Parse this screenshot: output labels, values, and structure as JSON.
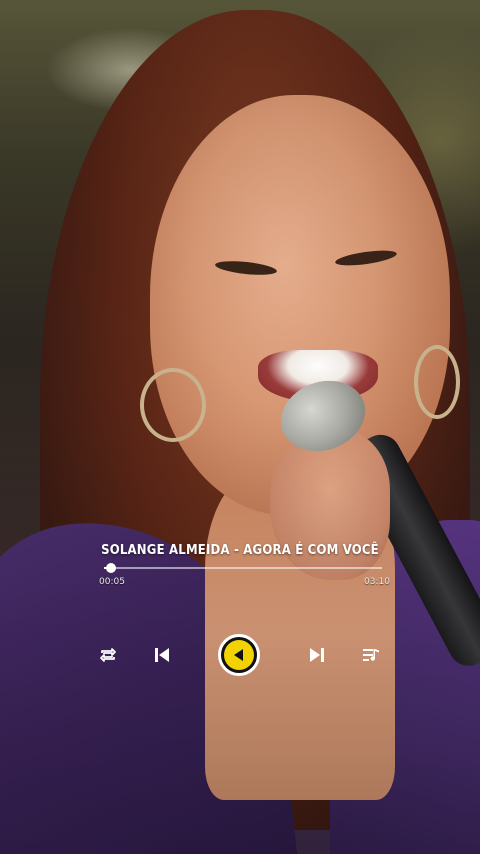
{
  "player": {
    "song_title": "SOLANGE ALMEIDA - AGORA É COM VOCÊ",
    "current_time": "00:05",
    "total_time": "03:10",
    "progress_fraction": 0.026,
    "accent_color": "#f2d200"
  },
  "controls": {
    "repeat_icon": "repeat-icon",
    "previous_icon": "skip-previous-icon",
    "play_icon": "play-icon",
    "next_icon": "skip-next-icon",
    "playlist_icon": "playlist-icon"
  }
}
